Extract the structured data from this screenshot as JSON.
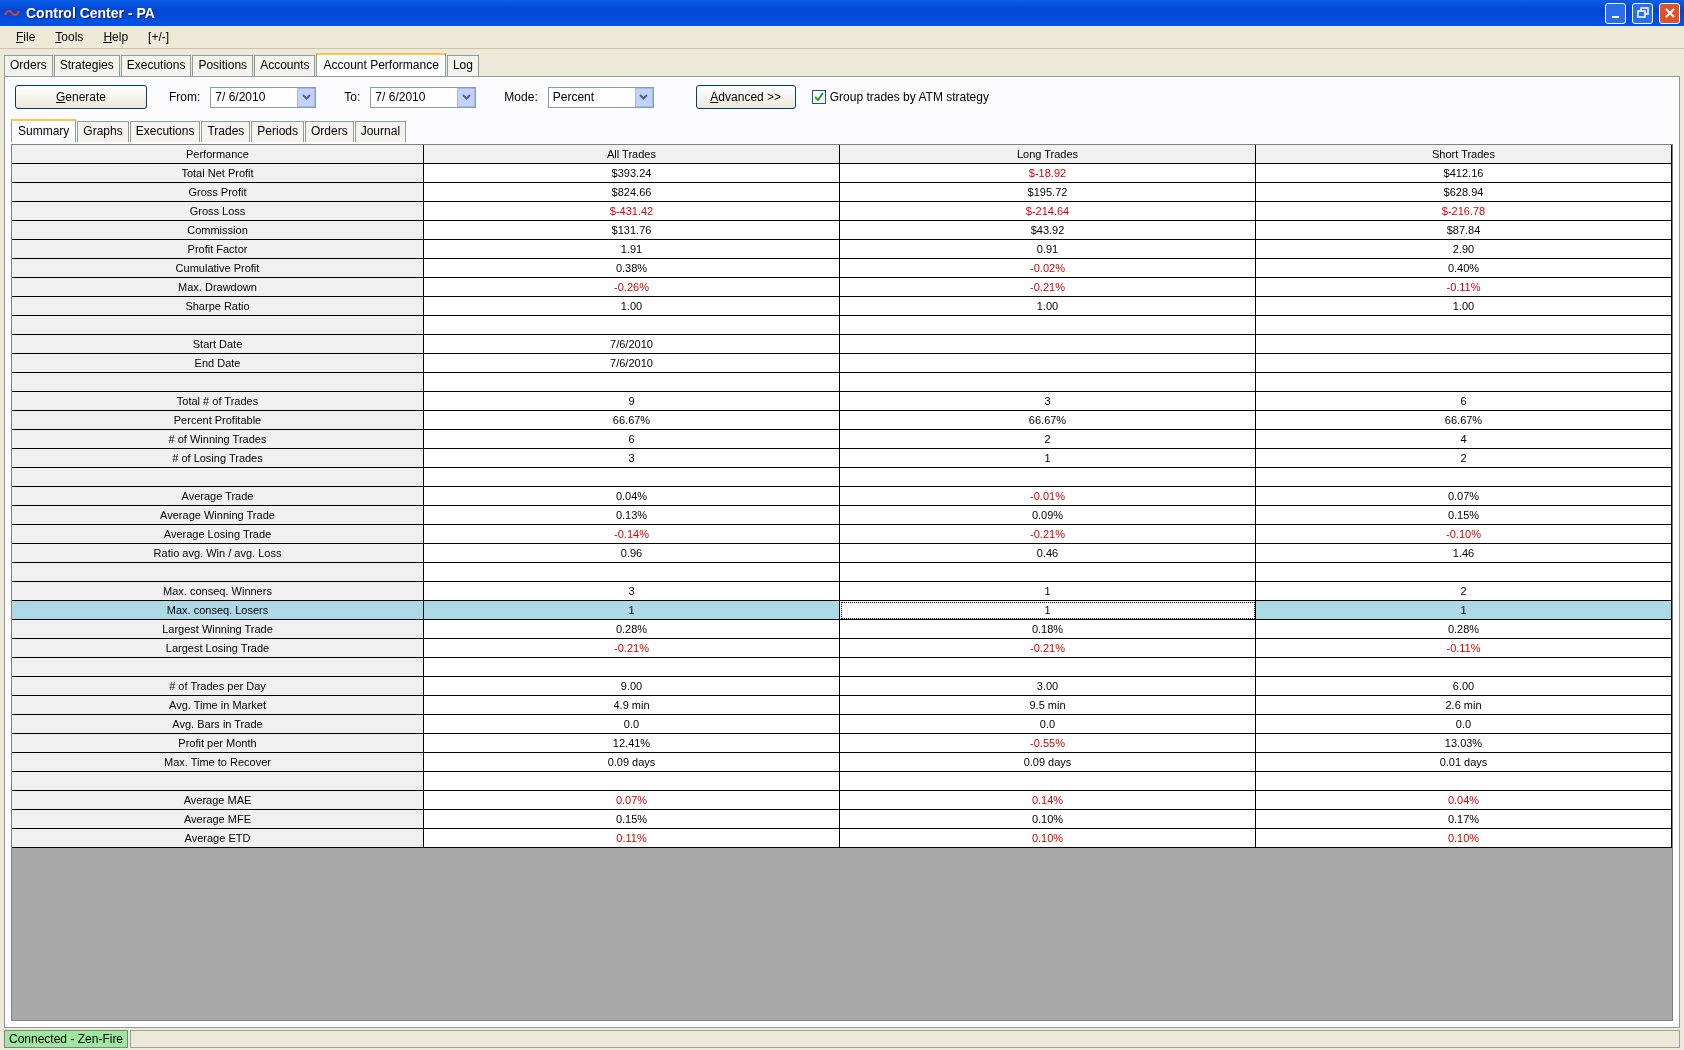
{
  "window": {
    "title": "Control Center - PA"
  },
  "menu": [
    {
      "label": "File",
      "mnemonic": true
    },
    {
      "label": "Tools",
      "mnemonic": true
    },
    {
      "label": "Help",
      "mnemonic": true
    },
    {
      "label": "[+/-]"
    }
  ],
  "tabs": [
    {
      "label": "Orders",
      "selected": false
    },
    {
      "label": "Strategies",
      "selected": false
    },
    {
      "label": "Executions",
      "selected": false
    },
    {
      "label": "Positions",
      "selected": false
    },
    {
      "label": "Accounts",
      "selected": false
    },
    {
      "label": "Account Performance",
      "selected": true
    },
    {
      "label": "Log",
      "selected": false
    }
  ],
  "toolbar": {
    "generate": {
      "label": "Generate",
      "mnemonic": true
    },
    "from_label": "From:",
    "from_value": "7/  6/2010",
    "to_label": "To:",
    "to_value": "7/  6/2010",
    "mode_label": "Mode:",
    "mode_value": "Percent",
    "advanced": {
      "label": "Advanced >>",
      "mnemonic": true
    },
    "group_checkbox": {
      "label": "Group trades by ATM strategy",
      "checked": true
    }
  },
  "subtabs": [
    {
      "label": "Summary",
      "selected": true
    },
    {
      "label": "Graphs",
      "selected": false
    },
    {
      "label": "Executions",
      "selected": false
    },
    {
      "label": "Trades",
      "selected": false
    },
    {
      "label": "Periods",
      "selected": false
    },
    {
      "label": "Orders",
      "selected": false
    },
    {
      "label": "Journal",
      "selected": false
    }
  ],
  "table": {
    "columns": [
      "Performance",
      "All Trades",
      "Long Trades",
      "Short Trades"
    ],
    "rows": [
      {
        "kind": "data",
        "selected": false,
        "label": "Total Net Profit",
        "cells": [
          {
            "text": "$393.24",
            "negative": false
          },
          {
            "text": "$-18.92",
            "negative": true
          },
          {
            "text": "$412.16",
            "negative": false
          }
        ]
      },
      {
        "kind": "data",
        "selected": false,
        "label": "Gross Profit",
        "cells": [
          {
            "text": "$824.66",
            "negative": false
          },
          {
            "text": "$195.72",
            "negative": false
          },
          {
            "text": "$628.94",
            "negative": false
          }
        ]
      },
      {
        "kind": "data",
        "selected": false,
        "label": "Gross Loss",
        "cells": [
          {
            "text": "$-431.42",
            "negative": true
          },
          {
            "text": "$-214.64",
            "negative": true
          },
          {
            "text": "$-216.78",
            "negative": true
          }
        ]
      },
      {
        "kind": "data",
        "selected": false,
        "label": "Commission",
        "cells": [
          {
            "text": "$131.76",
            "negative": false
          },
          {
            "text": "$43.92",
            "negative": false
          },
          {
            "text": "$87.84",
            "negative": false
          }
        ]
      },
      {
        "kind": "data",
        "selected": false,
        "label": "Profit Factor",
        "cells": [
          {
            "text": "1.91",
            "negative": false
          },
          {
            "text": "0.91",
            "negative": false
          },
          {
            "text": "2.90",
            "negative": false
          }
        ]
      },
      {
        "kind": "data",
        "selected": false,
        "label": "Cumulative Profit",
        "cells": [
          {
            "text": "0.38%",
            "negative": false
          },
          {
            "text": "-0.02%",
            "negative": true
          },
          {
            "text": "0.40%",
            "negative": false
          }
        ]
      },
      {
        "kind": "data",
        "selected": false,
        "label": "Max. Drawdown",
        "cells": [
          {
            "text": "-0.26%",
            "negative": true
          },
          {
            "text": "-0.21%",
            "negative": true
          },
          {
            "text": "-0.11%",
            "negative": true
          }
        ]
      },
      {
        "kind": "data",
        "selected": false,
        "label": "Sharpe Ratio",
        "cells": [
          {
            "text": "1.00",
            "negative": false
          },
          {
            "text": "1.00",
            "negative": false
          },
          {
            "text": "1.00",
            "negative": false
          }
        ]
      },
      {
        "kind": "blank",
        "selected": false
      },
      {
        "kind": "data",
        "selected": false,
        "label": "Start Date",
        "cells": [
          {
            "text": "7/6/2010",
            "negative": false
          }
        ]
      },
      {
        "kind": "data",
        "selected": false,
        "label": "End Date",
        "cells": [
          {
            "text": "7/6/2010",
            "negative": false
          }
        ]
      },
      {
        "kind": "blank",
        "selected": false
      },
      {
        "kind": "data",
        "selected": false,
        "label": "Total # of Trades",
        "cells": [
          {
            "text": "9",
            "negative": false
          },
          {
            "text": "3",
            "negative": false
          },
          {
            "text": "6",
            "negative": false
          }
        ]
      },
      {
        "kind": "data",
        "selected": false,
        "label": "Percent Profitable",
        "cells": [
          {
            "text": "66.67%",
            "negative": false
          },
          {
            "text": "66.67%",
            "negative": false
          },
          {
            "text": "66.67%",
            "negative": false
          }
        ]
      },
      {
        "kind": "data",
        "selected": false,
        "label": "# of Winning Trades",
        "cells": [
          {
            "text": "6",
            "negative": false
          },
          {
            "text": "2",
            "negative": false
          },
          {
            "text": "4",
            "negative": false
          }
        ]
      },
      {
        "kind": "data",
        "selected": false,
        "label": "# of Losing Trades",
        "cells": [
          {
            "text": "3",
            "negative": false
          },
          {
            "text": "1",
            "negative": false
          },
          {
            "text": "2",
            "negative": false
          }
        ]
      },
      {
        "kind": "blank",
        "selected": false
      },
      {
        "kind": "data",
        "selected": false,
        "label": "Average Trade",
        "cells": [
          {
            "text": "0.04%",
            "negative": false
          },
          {
            "text": "-0.01%",
            "negative": true
          },
          {
            "text": "0.07%",
            "negative": false
          }
        ]
      },
      {
        "kind": "data",
        "selected": false,
        "label": "Average Winning Trade",
        "cells": [
          {
            "text": "0.13%",
            "negative": false
          },
          {
            "text": "0.09%",
            "negative": false
          },
          {
            "text": "0.15%",
            "negative": false
          }
        ]
      },
      {
        "kind": "data",
        "selected": false,
        "label": "Average Losing Trade",
        "cells": [
          {
            "text": "-0.14%",
            "negative": true
          },
          {
            "text": "-0.21%",
            "negative": true
          },
          {
            "text": "-0.10%",
            "negative": true
          }
        ]
      },
      {
        "kind": "data",
        "selected": false,
        "label": "Ratio avg. Win / avg. Loss",
        "cells": [
          {
            "text": "0.96",
            "negative": false
          },
          {
            "text": "0.46",
            "negative": false
          },
          {
            "text": "1.46",
            "negative": false
          }
        ]
      },
      {
        "kind": "blank",
        "selected": false
      },
      {
        "kind": "data",
        "selected": false,
        "label": "Max. conseq. Winners",
        "cells": [
          {
            "text": "3",
            "negative": false
          },
          {
            "text": "1",
            "negative": false
          },
          {
            "text": "2",
            "negative": false
          }
        ]
      },
      {
        "kind": "data",
        "selected": true,
        "label": "Max. conseq. Losers",
        "cells": [
          {
            "text": "1",
            "negative": false
          },
          {
            "text": "1",
            "negative": false
          },
          {
            "text": "1",
            "negative": false
          }
        ]
      },
      {
        "kind": "data",
        "selected": false,
        "label": "Largest Winning Trade",
        "cells": [
          {
            "text": "0.28%",
            "negative": false
          },
          {
            "text": "0.18%",
            "negative": false
          },
          {
            "text": "0.28%",
            "negative": false
          }
        ]
      },
      {
        "kind": "data",
        "selected": false,
        "label": "Largest Losing Trade",
        "cells": [
          {
            "text": "-0.21%",
            "negative": true
          },
          {
            "text": "-0.21%",
            "negative": true
          },
          {
            "text": "-0.11%",
            "negative": true
          }
        ]
      },
      {
        "kind": "blank",
        "selected": false
      },
      {
        "kind": "data",
        "selected": false,
        "label": "# of Trades per Day",
        "cells": [
          {
            "text": "9.00",
            "negative": false
          },
          {
            "text": "3.00",
            "negative": false
          },
          {
            "text": "6.00",
            "negative": false
          }
        ]
      },
      {
        "kind": "data",
        "selected": false,
        "label": "Avg. Time in Market",
        "cells": [
          {
            "text": "4.9 min",
            "negative": false
          },
          {
            "text": "9.5 min",
            "negative": false
          },
          {
            "text": "2.6 min",
            "negative": false
          }
        ]
      },
      {
        "kind": "data",
        "selected": false,
        "label": "Avg. Bars in Trade",
        "cells": [
          {
            "text": "0.0",
            "negative": false
          },
          {
            "text": "0.0",
            "negative": false
          },
          {
            "text": "0.0",
            "negative": false
          }
        ]
      },
      {
        "kind": "data",
        "selected": false,
        "label": "Profit per Month",
        "cells": [
          {
            "text": "12.41%",
            "negative": false
          },
          {
            "text": "-0.55%",
            "negative": true
          },
          {
            "text": "13.03%",
            "negative": false
          }
        ]
      },
      {
        "kind": "data",
        "selected": false,
        "label": "Max. Time to Recover",
        "cells": [
          {
            "text": "0.09 days",
            "negative": false
          },
          {
            "text": "0.09 days",
            "negative": false
          },
          {
            "text": "0.01 days",
            "negative": false
          }
        ]
      },
      {
        "kind": "blank",
        "selected": false
      },
      {
        "kind": "data",
        "selected": false,
        "label": "Average MAE",
        "cells": [
          {
            "text": "0.07%",
            "negative": true
          },
          {
            "text": "0.14%",
            "negative": true
          },
          {
            "text": "0.04%",
            "negative": true
          }
        ]
      },
      {
        "kind": "data",
        "selected": false,
        "label": "Average MFE",
        "cells": [
          {
            "text": "0.15%",
            "negative": false
          },
          {
            "text": "0.10%",
            "negative": false
          },
          {
            "text": "0.17%",
            "negative": false
          }
        ]
      },
      {
        "kind": "data",
        "selected": false,
        "label": "Average ETD",
        "cells": [
          {
            "text": "0.11%",
            "negative": true
          },
          {
            "text": "0.10%",
            "negative": true
          },
          {
            "text": "0.10%",
            "negative": true
          }
        ]
      }
    ]
  },
  "status_bar": {
    "connection": "Connected - Zen-Fire"
  }
}
